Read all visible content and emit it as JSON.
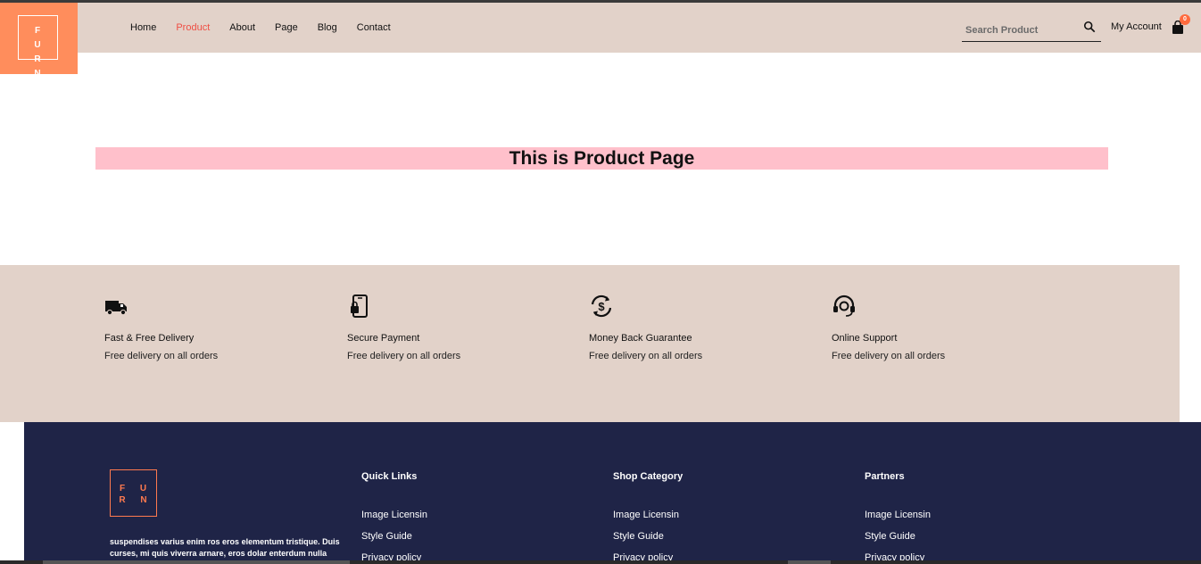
{
  "brand": {
    "logo_letters_row1": "F U",
    "logo_letters_row2": "R N"
  },
  "nav": {
    "items": [
      {
        "label": "Home",
        "active": false
      },
      {
        "label": "Product",
        "active": true
      },
      {
        "label": "About",
        "active": false
      },
      {
        "label": "Page",
        "active": false
      },
      {
        "label": "Blog",
        "active": false
      },
      {
        "label": "Contact",
        "active": false
      }
    ]
  },
  "search": {
    "placeholder": "Search Product",
    "icon": "search-icon"
  },
  "account": {
    "label": "My Account"
  },
  "cart": {
    "count": "0",
    "icon": "shopping-bag-icon"
  },
  "main": {
    "title": "This is Product Page"
  },
  "features": [
    {
      "icon": "truck-icon",
      "title": "Fast & Free Delivery",
      "desc": "Free delivery on all orders"
    },
    {
      "icon": "mobile-lock-icon",
      "title": "Secure Payment",
      "desc": "Free delivery on all orders"
    },
    {
      "icon": "money-back-icon",
      "title": "Money Back Guarantee",
      "desc": "Free delivery on all orders"
    },
    {
      "icon": "headset-icon",
      "title": "Online Support",
      "desc": "Free delivery on all orders"
    }
  ],
  "footer": {
    "logo_row1": "F U",
    "logo_row2": "R N",
    "description": "suspendises varius enim ros eros elementum tristique. Duis curses, mi quis viverra arnare, eros dolar enterdum nulla",
    "columns": [
      {
        "heading": "Quick Links",
        "links": [
          "Image Licensin",
          "Style Guide",
          "Privacy policy"
        ]
      },
      {
        "heading": "Shop Category",
        "links": [
          "Image Licensin",
          "Style Guide",
          "Privacy policy"
        ]
      },
      {
        "heading": "Partners",
        "links": [
          "Image Licensin",
          "Style Guide",
          "Privacy policy"
        ]
      }
    ]
  },
  "colors": {
    "header_bg": "#e2d2c9",
    "logo_bg": "#ff8d5c",
    "active_nav": "#ef4f44",
    "title_bar_bg": "#ffc0cb",
    "footer_bg": "#1f2447",
    "footer_logo": "#ff7a4f",
    "badge": "#ff6a3d"
  }
}
